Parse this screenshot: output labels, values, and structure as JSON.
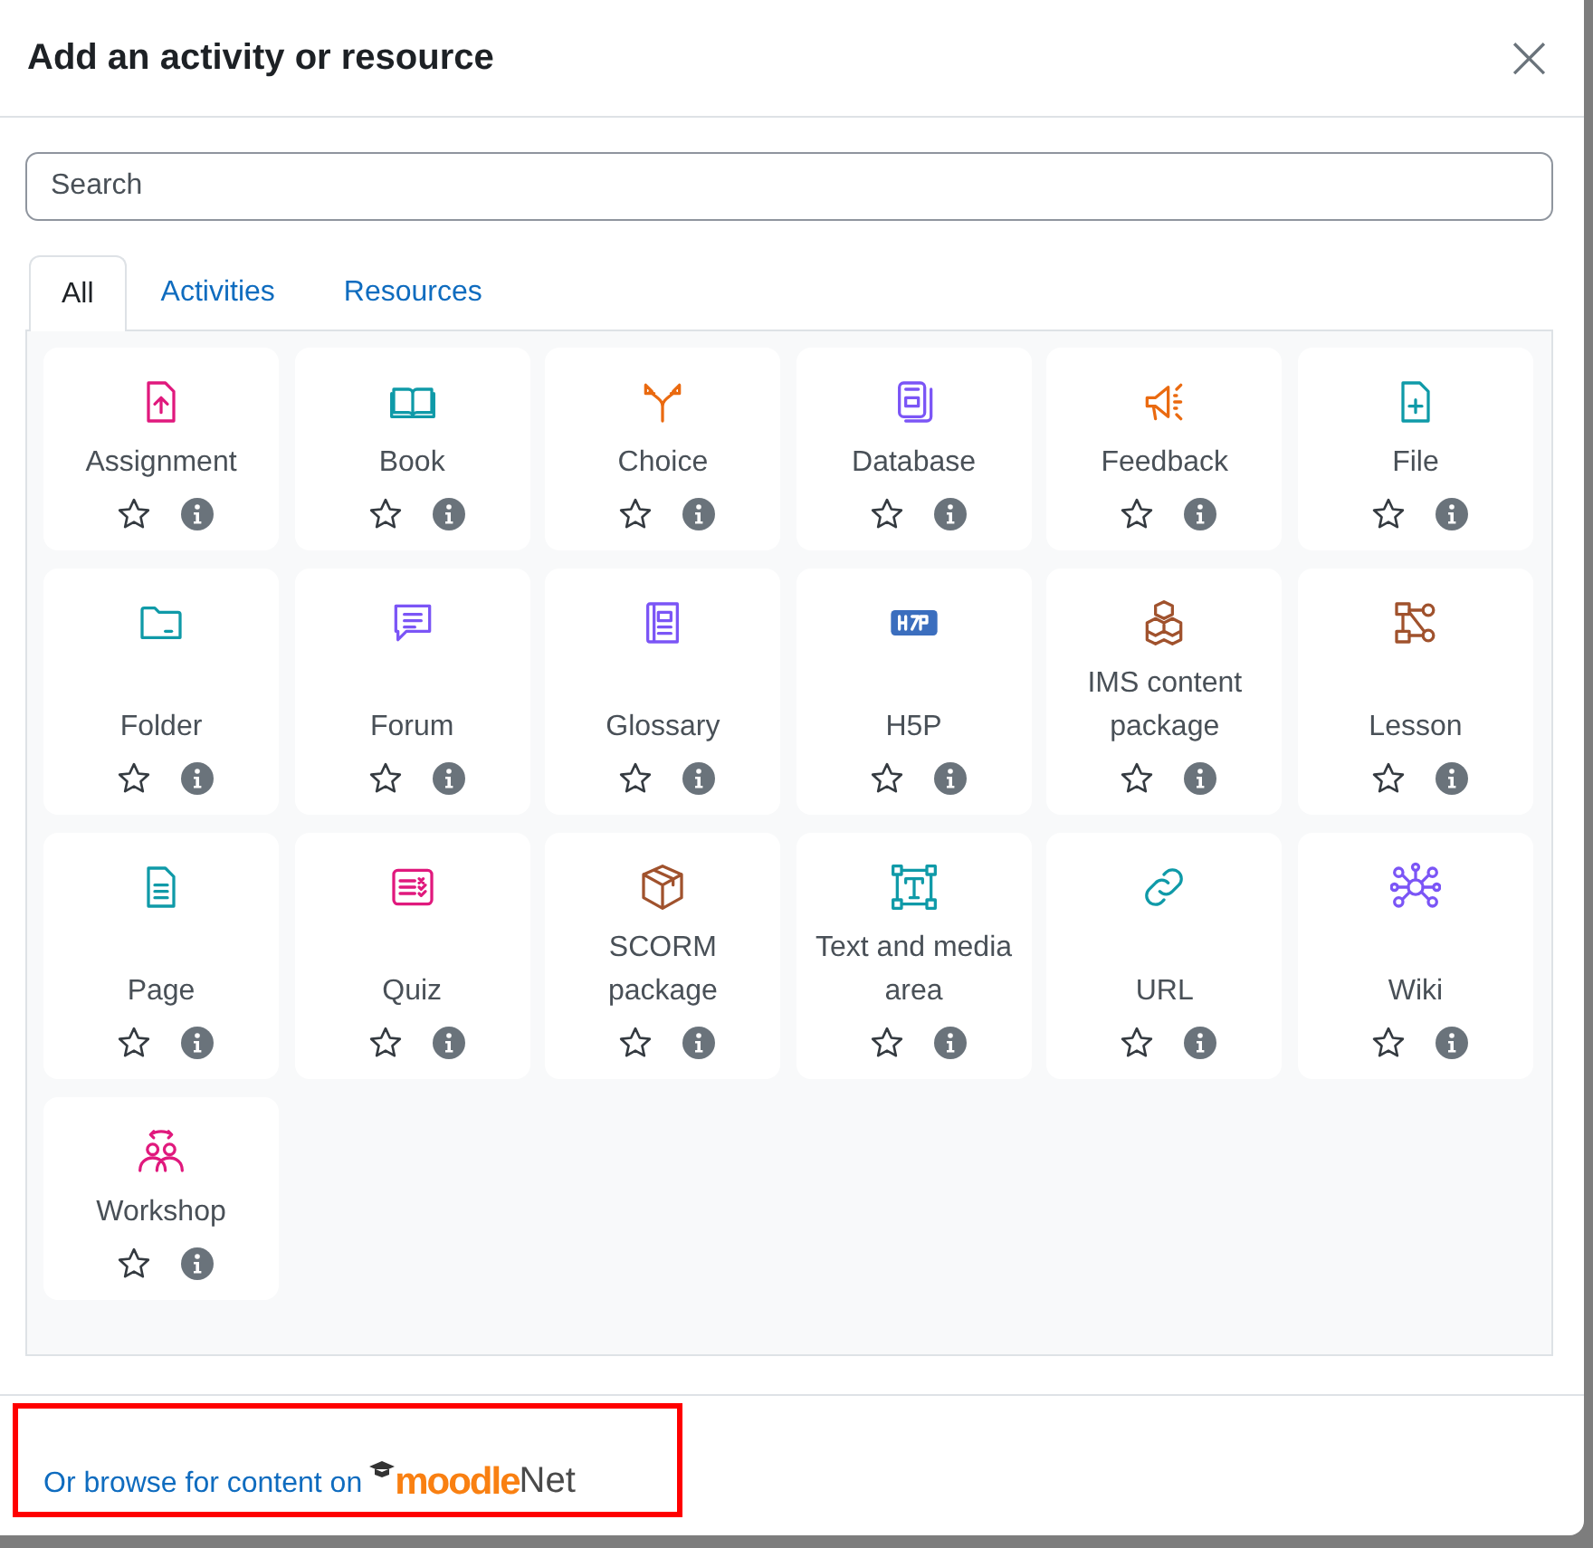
{
  "dialog": {
    "title": "Add an activity or resource",
    "close": "×"
  },
  "search": {
    "placeholder": "Search"
  },
  "tabs": [
    {
      "label": "All",
      "selected": true
    },
    {
      "label": "Activities",
      "selected": false
    },
    {
      "label": "Resources",
      "selected": false
    }
  ],
  "items": [
    {
      "label": "Assignment",
      "starred": false
    },
    {
      "label": "Book",
      "starred": false
    },
    {
      "label": "Choice",
      "starred": false
    },
    {
      "label": "Database",
      "starred": false
    },
    {
      "label": "Feedback",
      "starred": false
    },
    {
      "label": "File",
      "starred": false
    },
    {
      "label": "Folder",
      "starred": false
    },
    {
      "label": "Forum",
      "starred": false
    },
    {
      "label": "Glossary",
      "starred": false
    },
    {
      "label": "H5P",
      "starred": false
    },
    {
      "label": "IMS content package",
      "starred": false
    },
    {
      "label": "Lesson",
      "starred": false
    },
    {
      "label": "Page",
      "starred": false
    },
    {
      "label": "Quiz",
      "starred": false
    },
    {
      "label": "SCORM package",
      "starred": false
    },
    {
      "label": "Text and media area",
      "starred": false
    },
    {
      "label": "URL",
      "starred": false
    },
    {
      "label": "Wiki",
      "starred": false
    },
    {
      "label": "Workshop",
      "starred": false
    }
  ],
  "footer": {
    "link": "Or browse for content on",
    "logo": {
      "primary": "moodle",
      "secondary": "Net"
    },
    "highlighted": true
  }
}
